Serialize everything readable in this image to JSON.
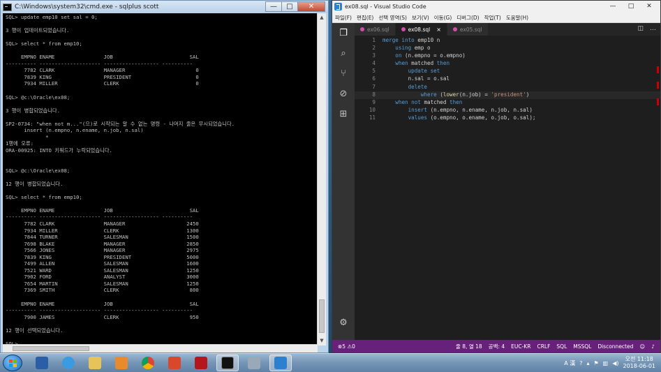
{
  "cmd": {
    "title": "C:\\Windows\\system32\\cmd.exe - sqlplus  scott",
    "lines": [
      "SQL> update emp10 set sal = 0;",
      "",
      "3 행이 업데이트되었습니다.",
      "",
      "SQL> select * from emp10;",
      "",
      "     EMPNO ENAME                JOB                         SAL",
      "---------- -------------------- ------------------ ----------",
      "      7782 CLARK                MANAGER                       0",
      "      7839 KING                 PRESIDENT                     0",
      "      7934 MILLER               CLERK                         0",
      "",
      "SQL> @c:\\Oracle\\ex08;",
      "",
      "3 행이 병합되었습니다.",
      "",
      "SP2-0734: \"when not m...\"(으)로 시작되는 알 수 없는 명령 - 나머지 줄은 무시되었습니다.",
      "      insert (n.empno, n.ename, n.job, n.sal)",
      "             *",
      "1행에 오류:",
      "ORA-00925: INTO 키워드가 누락되었습니다.",
      "",
      "",
      "SQL> @c:\\Oracle\\ex08;",
      "",
      "12 행이 병합되었습니다.",
      "",
      "SQL> select * from emp10;",
      "",
      "     EMPNO ENAME                JOB                         SAL",
      "---------- -------------------- ------------------ ----------",
      "      7782 CLARK                MANAGER                    2450",
      "      7934 MILLER               CLERK                      1300",
      "      7844 TURNER               SALESMAN                   1500",
      "      7698 BLAKE                MANAGER                    2850",
      "      7566 JONES                MANAGER                    2975",
      "      7839 KING                 PRESIDENT                  5000",
      "      7499 ALLEN                SALESMAN                   1600",
      "      7521 WARD                 SALESMAN                   1250",
      "      7902 FORD                 ANALYST                    3000",
      "      7654 MARTIN               SALESMAN                   1250",
      "      7369 SMITH                CLERK                       800",
      "",
      "     EMPNO ENAME                JOB                         SAL",
      "---------- -------------------- ------------------ ----------",
      "      7900 JAMES                CLERK                       950",
      "",
      "12 행이 선택되었습니다.",
      "",
      "SQL> _"
    ]
  },
  "vscode": {
    "title": "ex08.sql - Visual Studio Code",
    "menu": [
      "파일(F)",
      "편집(E)",
      "선택 영역(S)",
      "보기(V)",
      "이동(G)",
      "디버그(D)",
      "작업(T)",
      "도움말(H)"
    ],
    "tabs": [
      {
        "label": "ex06.sql",
        "active": false
      },
      {
        "label": "ex08.sql",
        "active": true,
        "close": "×"
      },
      {
        "label": "ex05.sql",
        "active": false
      }
    ],
    "line_numbers": [
      "1",
      "2",
      "3",
      "4",
      "5",
      "6",
      "7",
      "8",
      "9",
      "10",
      "11"
    ],
    "status": {
      "problems": "⊗5 ⚠0",
      "position": "줄 8, 열 18",
      "spaces": "공백: 4",
      "encoding": "EUC-KR",
      "eol": "CRLF",
      "language": "SQL",
      "dialect": "MSSQL",
      "connection": "Disconnected"
    },
    "minimise": "—",
    "maximise": "□",
    "close": "✕"
  },
  "taskbar": {
    "ime": "A 漢",
    "time": "오전 11:18",
    "date": "2018-06-01"
  },
  "colors": {
    "vscode_statusbar": "#68217a",
    "sql_keyword": "#569cd6",
    "sql_string": "#ce9178",
    "sql_function": "#dcdcaa"
  }
}
